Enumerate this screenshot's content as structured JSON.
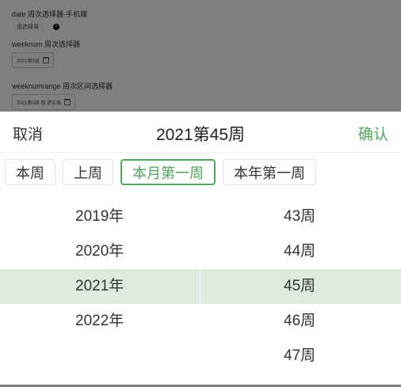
{
  "background": {
    "date_label": "date 周次选择器-手机端",
    "date_placeholder": "请选择周",
    "weeknum_label": "weeknum 周次选择器",
    "weeknum_value": "2021第5周",
    "weeknumrange_label": "weeknumrange 周次区间选择器",
    "weeknumrange_value": "2021第5周 到 请实周"
  },
  "picker": {
    "cancel": "取消",
    "title": "2021第45周",
    "confirm": "确认",
    "shortcuts": [
      "本周",
      "上周",
      "本月第一周",
      "本年第一周"
    ],
    "active_shortcut": "本月第一周",
    "years": [
      "2019年",
      "2020年",
      "2021年",
      "2022年"
    ],
    "selected_year": "2021年",
    "weeks": [
      "43周",
      "44周",
      "45周",
      "46周",
      "47周"
    ],
    "selected_week": "45周"
  },
  "colors": {
    "accent": "#52a35b",
    "selected_row": "#dcebdd"
  }
}
